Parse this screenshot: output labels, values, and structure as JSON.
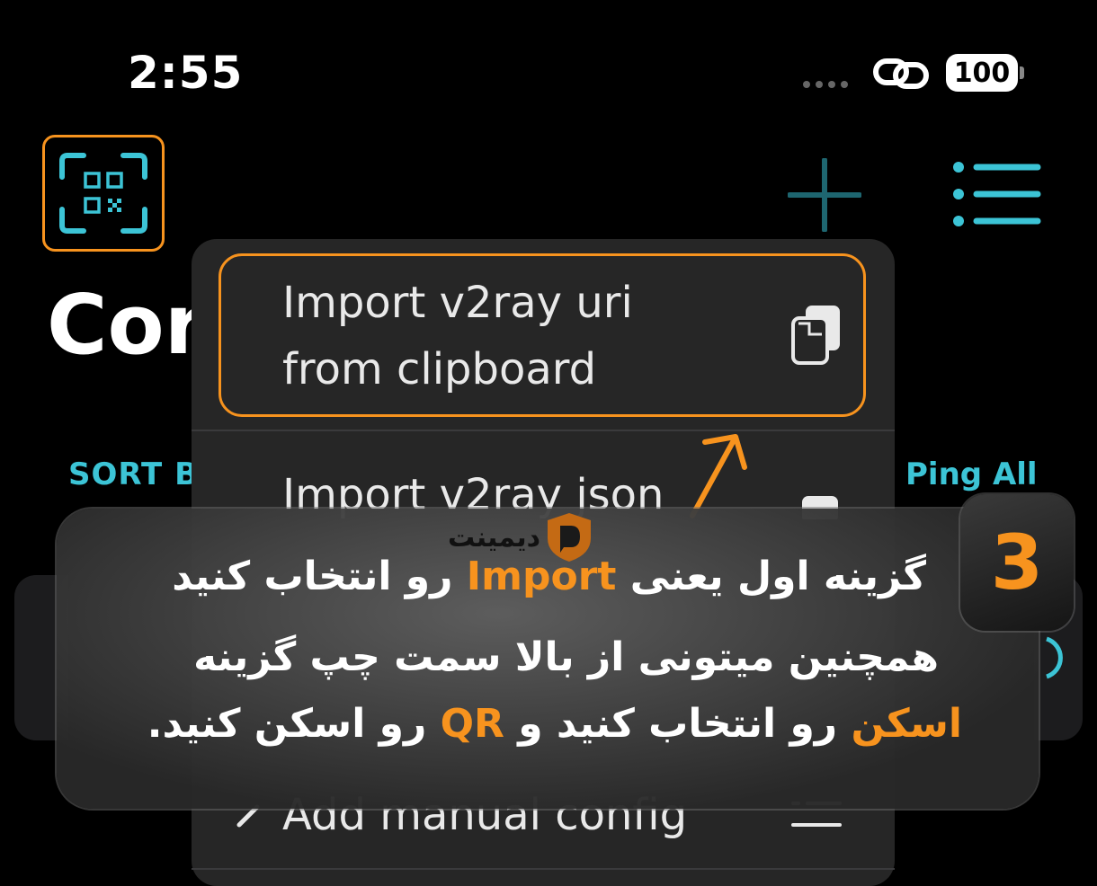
{
  "status_bar": {
    "time": "2:55",
    "battery": "100"
  },
  "toolbar": {
    "scan_icon": "qr-scan-icon",
    "add_icon": "plus-icon",
    "menu_icon": "list-menu-icon"
  },
  "page": {
    "title_partial": "Cor",
    "sort_label": "SORT B",
    "ping_all": "Ping All"
  },
  "menu": {
    "items": [
      {
        "line1": "Import v2ray uri",
        "line2": "from clipboard",
        "icon": "clipboard-icon"
      },
      {
        "label": "Import v2ray json",
        "icon": "clipboard-icon"
      },
      {
        "label": "Add manual config",
        "icon": "list-icon"
      }
    ]
  },
  "overlay": {
    "step": "3",
    "logo_text": "دیمینت",
    "line1": {
      "pre": "گزینه اول یعنی ",
      "hl": "Import",
      "post": " رو انتخاب کنید"
    },
    "line2": "همچنین میتونی از بالا سمت چپ گزینه",
    "line3": {
      "hl1": "اسکن",
      "mid": " رو انتخاب کنید و ",
      "hl2": "QR",
      "post": " رو اسکن کنید."
    }
  },
  "colors": {
    "accent_orange": "#f7931e",
    "accent_cyan": "#3cc4d6",
    "background": "#000000",
    "menu_bg": "#262626"
  }
}
